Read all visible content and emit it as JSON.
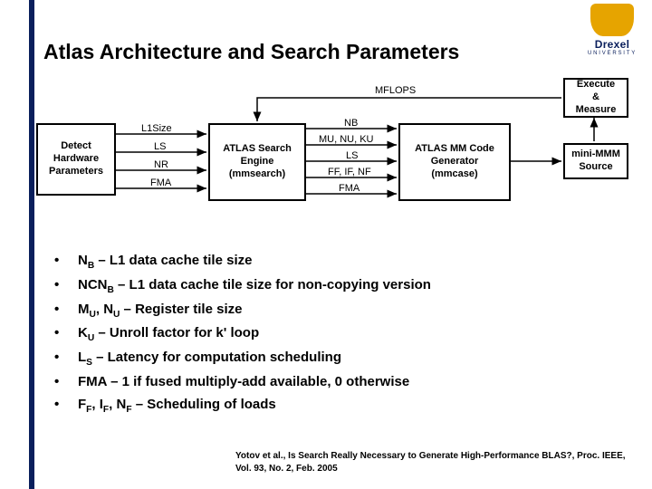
{
  "brand": {
    "name": "Drexel",
    "sub": "UNIVERSITY"
  },
  "title": "Atlas Architecture and Search Parameters",
  "diagram": {
    "boxes": {
      "detect": "Detect\nHardware\nParameters",
      "engine": "ATLAS Search\nEngine\n(mmsearch)",
      "codegen": "ATLAS MM Code\nGenerator\n(mmcase)",
      "execute": "Execute\n&\nMeasure",
      "source": "mini-MMM\nSource"
    },
    "edge_labels": {
      "mflops": "MFLOPS",
      "l1size": "L1Size",
      "ls": "LS",
      "nr": "NR",
      "fma": "FMA",
      "nb": "NB",
      "munu": "MU, NU, KU",
      "ls2": "LS",
      "ffifnf": "FF, IF, NF",
      "fma2": "FMA"
    }
  },
  "bullets": [
    {
      "term": "N",
      "sub": "B",
      "rest": " – L1 data cache tile size"
    },
    {
      "term": "NCN",
      "sub": "B",
      "rest": " – L1 data cache tile size for non-copying version"
    },
    {
      "multi": [
        {
          "t": "M",
          "s": "U"
        },
        {
          "plain": ", "
        },
        {
          "t": "N",
          "s": "U"
        }
      ],
      "rest": " – Register tile size"
    },
    {
      "term": "K",
      "sub": "U",
      "rest": " – Unroll factor for k' loop"
    },
    {
      "term": "L",
      "sub": "S",
      "rest": " – Latency for computation scheduling"
    },
    {
      "plainterm": "FMA",
      "rest": " – 1 if fused multiply-add available, 0 otherwise"
    },
    {
      "multi": [
        {
          "t": "F",
          "s": "F"
        },
        {
          "plain": ", "
        },
        {
          "t": "I",
          "s": "F"
        },
        {
          "plain": ", "
        },
        {
          "t": "N",
          "s": "F"
        }
      ],
      "rest": " – Scheduling of loads"
    }
  ],
  "citation": "Yotov et al., Is Search Really Necessary to Generate High-Performance BLAS?, Proc. IEEE, Vol. 93, No. 2, Feb. 2005"
}
